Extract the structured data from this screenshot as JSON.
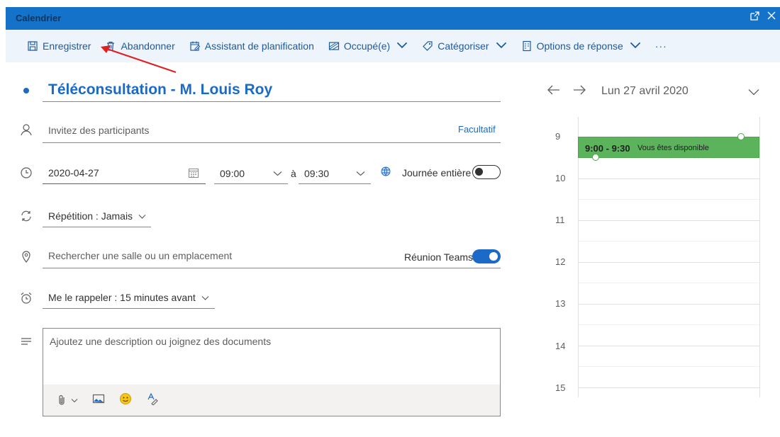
{
  "window": {
    "title": "Calendrier"
  },
  "toolbar": {
    "save": "Enregistrer",
    "discard": "Abandonner",
    "scheduling": "Assistant de planification",
    "busy": "Occupé(e)",
    "categorize": "Catégoriser",
    "response_options": "Options de réponse",
    "more": "···"
  },
  "event": {
    "title": "Téléconsultation - M. Louis Roy",
    "attendees_placeholder": "Invitez des participants",
    "optional_link": "Facultatif",
    "start_date": "2020-04-27",
    "start_time": "09:00",
    "to_label": "à",
    "end_time": "09:30",
    "all_day_label": "Journée entière",
    "all_day": false,
    "repeat": "Répétition : Jamais",
    "location_placeholder": "Rechercher une salle ou un emplacement",
    "teams_label": "Réunion Teams",
    "teams_enabled": true,
    "reminder": "Me le rappeler : 15 minutes avant",
    "description_placeholder": "Ajoutez une description ou joignez des documents"
  },
  "day_view": {
    "date_label": "Lun 27 avril 2020",
    "hours": [
      "9",
      "10",
      "11",
      "12",
      "13",
      "14",
      "15"
    ],
    "event_time": "9:00 - 9:30",
    "event_status": "Vous êtes disponible",
    "event_color": "#5bb35c"
  },
  "colors": {
    "accent": "#1b6ac6",
    "titlebar": "#1572c9",
    "toolbar_bg": "#eef4fb",
    "annotation_arrow": "#e02020"
  }
}
